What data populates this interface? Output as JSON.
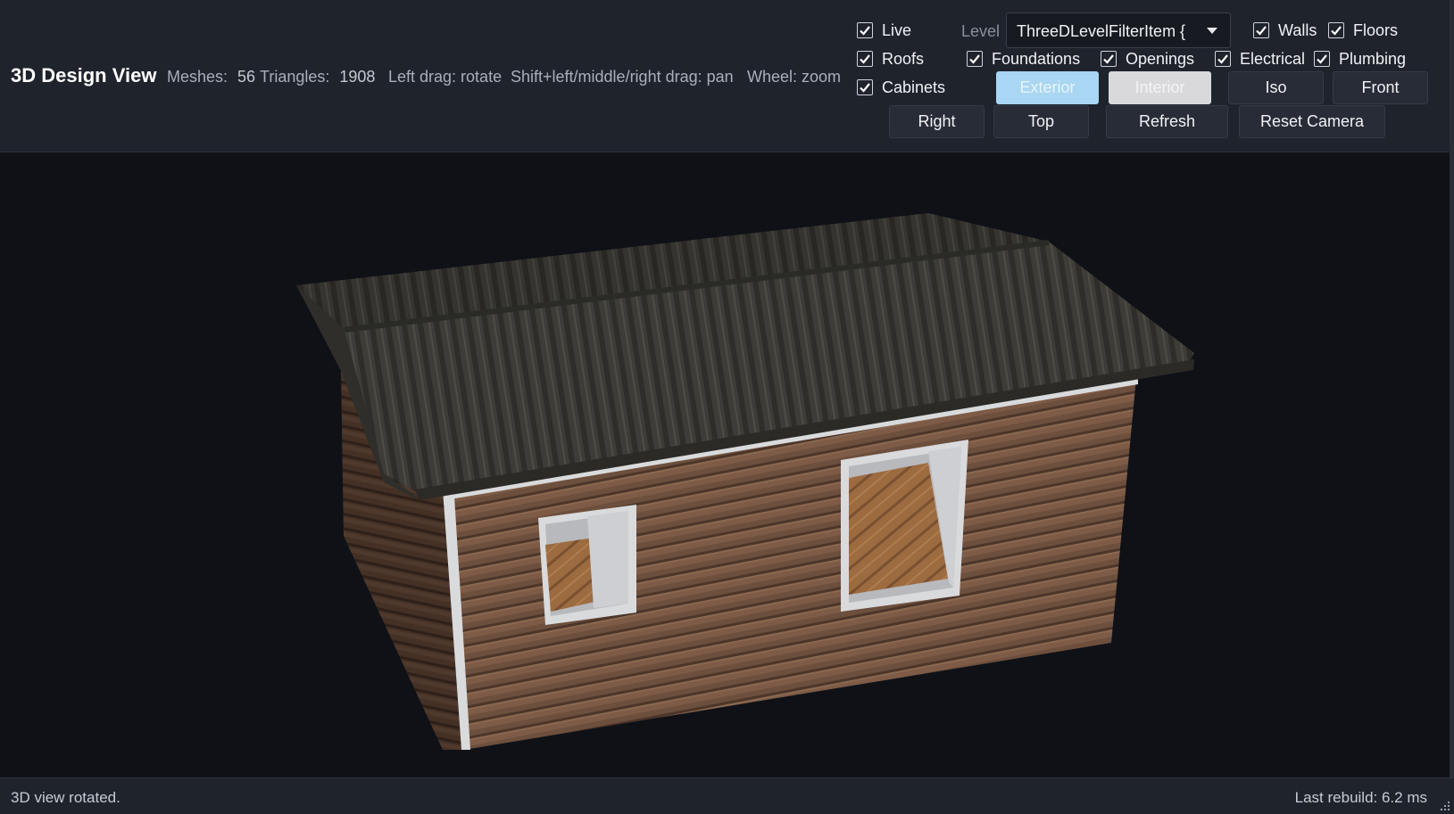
{
  "header": {
    "title": "3D Design View",
    "meshes_label": "Meshes:",
    "meshes_value": "56",
    "triangles_label": "Triangles:",
    "triangles_value": "1908",
    "hint_rotate": "Left drag: rotate",
    "hint_pan": "Shift+left/middle/right drag: pan",
    "hint_zoom": "Wheel: zoom"
  },
  "controls": {
    "live": {
      "label": "Live",
      "checked": true
    },
    "level_label": "Level",
    "level_value": "ThreeDLevelFilterItem { L",
    "walls": {
      "label": "Walls",
      "checked": true
    },
    "floors": {
      "label": "Floors",
      "checked": true
    },
    "roofs": {
      "label": "Roofs",
      "checked": true
    },
    "foundations": {
      "label": "Foundations",
      "checked": true
    },
    "openings": {
      "label": "Openings",
      "checked": true
    },
    "electrical": {
      "label": "Electrical",
      "checked": true
    },
    "plumbing": {
      "label": "Plumbing",
      "checked": true
    },
    "cabinets": {
      "label": "Cabinets",
      "checked": true
    },
    "exterior_label": "Exterior",
    "interior_label": "Interior",
    "iso_label": "Iso",
    "front_label": "Front",
    "right_label": "Right",
    "top_label": "Top",
    "refresh_label": "Refresh",
    "reset_camera_label": "Reset Camera"
  },
  "status": {
    "message": "3D view rotated.",
    "last_rebuild": "Last rebuild: 6.2 ms"
  },
  "colors": {
    "accent_selected": "#a9d6f2",
    "roof": "#3b3a35",
    "siding": "#6f5140",
    "trim": "#d9dadc",
    "floor_wood": "#9a6a40"
  },
  "icons": [
    "check-icon",
    "chevron-down-icon",
    "resize-grip-icon"
  ]
}
